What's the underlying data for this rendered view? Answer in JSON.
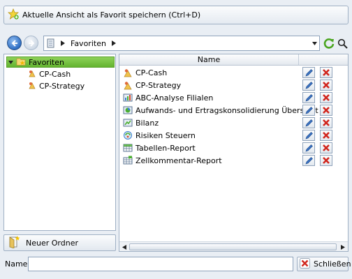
{
  "favorite_button": {
    "label": "Aktuelle Ansicht als Favorit speichern (Ctrl+D)",
    "icon": "star-add-icon"
  },
  "address_bar": {
    "crumb": "Favoriten"
  },
  "tree": {
    "root": {
      "label": "Favoriten",
      "icon": "favorites-folder-icon"
    },
    "children": [
      {
        "label": "CP-Cash",
        "icon": "cp-report-icon"
      },
      {
        "label": "CP-Strategy",
        "icon": "cp-report-icon"
      }
    ]
  },
  "new_folder_button": {
    "label": "Neuer Ordner",
    "icon": "new-folder-icon"
  },
  "list": {
    "column_header": "Name",
    "items": [
      {
        "label": "CP-Cash",
        "icon": "cp-report-icon"
      },
      {
        "label": "CP-Strategy",
        "icon": "cp-report-icon"
      },
      {
        "label": "ABC-Analyse Filialen",
        "icon": "analysis-report-icon"
      },
      {
        "label": "Aufwands- und Ertragskonsolidierung Übersicht",
        "icon": "consolidation-report-icon"
      },
      {
        "label": "Bilanz",
        "icon": "balance-report-icon"
      },
      {
        "label": "Risiken Steuern",
        "icon": "risk-report-icon"
      },
      {
        "label": "Tabellen-Report",
        "icon": "table-report-icon"
      },
      {
        "label": "Zellkommentar-Report",
        "icon": "comment-report-icon"
      }
    ]
  },
  "name_field": {
    "label": "Name:",
    "value": ""
  },
  "close_button": {
    "label": "Schließen",
    "icon": "close-x-icon"
  },
  "colors": {
    "accent_green": "#63b42f",
    "delete_red": "#d1261e",
    "edit_blue": "#3a72c2"
  }
}
